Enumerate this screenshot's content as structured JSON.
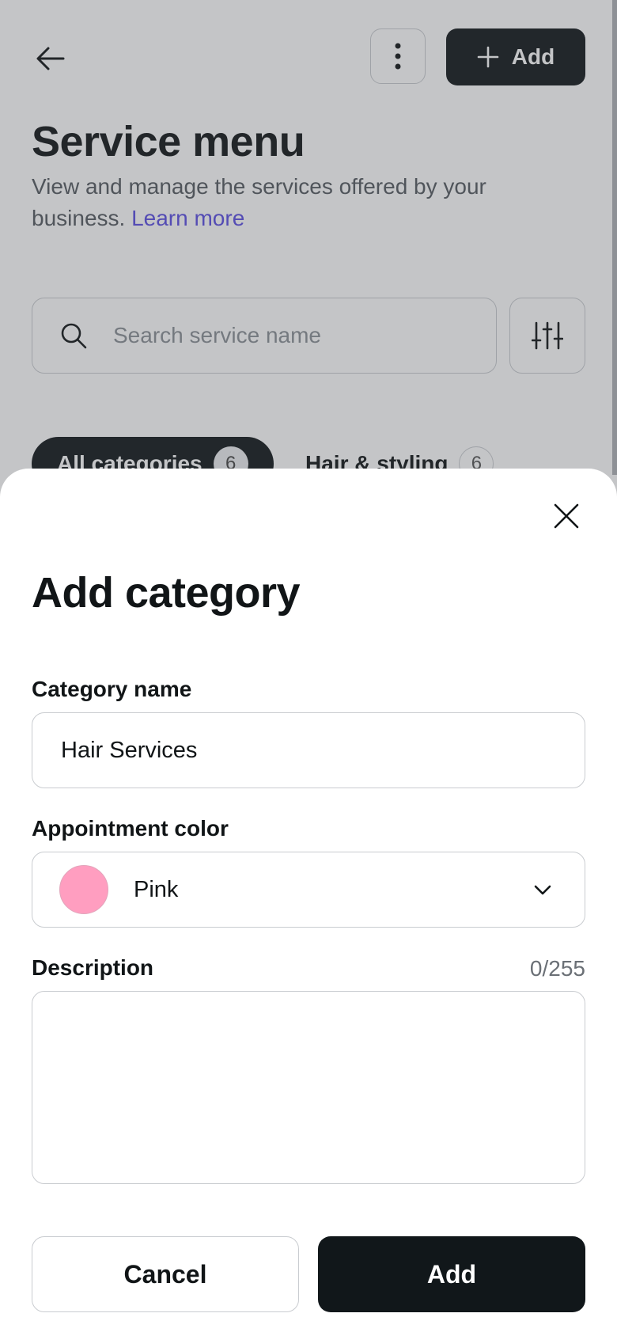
{
  "background_page": {
    "title": "Service menu",
    "subtitle": "View and manage the services offered by your business.",
    "learn_more": "Learn more",
    "add_button_label": "Add",
    "search_placeholder": "Search service name",
    "chips": [
      {
        "label": "All categories",
        "count": "6"
      },
      {
        "label": "Hair & styling",
        "count": "6"
      }
    ]
  },
  "dialog": {
    "title": "Add category",
    "category_name": {
      "label": "Category name",
      "value": "Hair Services"
    },
    "appointment_color": {
      "label": "Appointment color",
      "value": "Pink",
      "swatch_color": "#ff9ec0"
    },
    "description": {
      "label": "Description",
      "counter": "0/255",
      "value": ""
    },
    "cancel_label": "Cancel",
    "add_label": "Add"
  },
  "colors": {
    "primary": "#11171a",
    "link": "#5b4de3",
    "border": "#c9ccd0"
  },
  "icons": [
    "arrow-left-icon",
    "more-vertical-icon",
    "plus-icon",
    "search-icon",
    "sliders-icon",
    "close-icon",
    "chevron-down-icon"
  ]
}
